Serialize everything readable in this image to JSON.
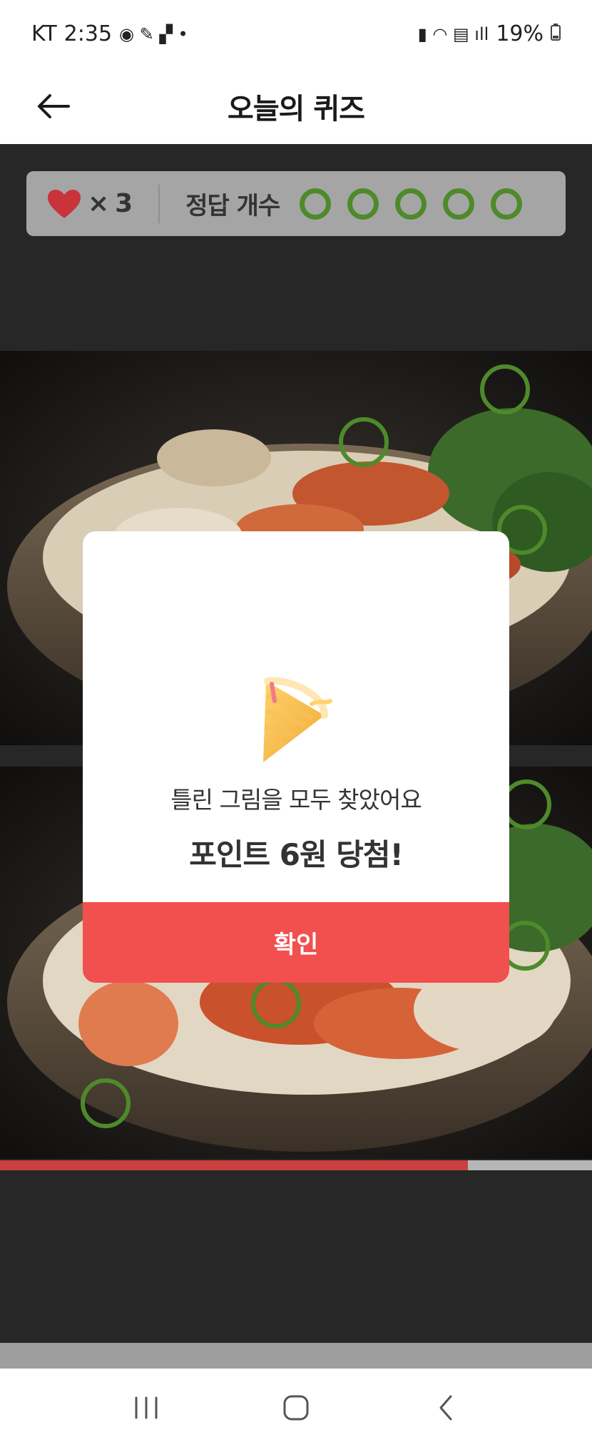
{
  "status_bar": {
    "carrier": "KT",
    "time": "2:35",
    "battery": "19%"
  },
  "header": {
    "title": "오늘의 퀴즈"
  },
  "score": {
    "lives_count": "3",
    "lives_prefix": "×",
    "answer_label": "정답 개수",
    "answers_total": 5
  },
  "progress": {
    "fraction": 0.79
  },
  "modal": {
    "message": "틀린 그림을 모두 찾았어요",
    "prize": "포인트 6원 당첨!",
    "confirm_label": "확인"
  },
  "colors": {
    "accent_red": "#f24f4f",
    "found_green": "#4e8a2a",
    "heart_red": "#c9333a"
  },
  "icons": {
    "back": "arrow-left-icon",
    "heart": "heart-icon",
    "party": "party-popper-icon",
    "nav_recent": "recent-apps-icon",
    "nav_home": "home-icon",
    "nav_back": "chevron-left-icon"
  }
}
